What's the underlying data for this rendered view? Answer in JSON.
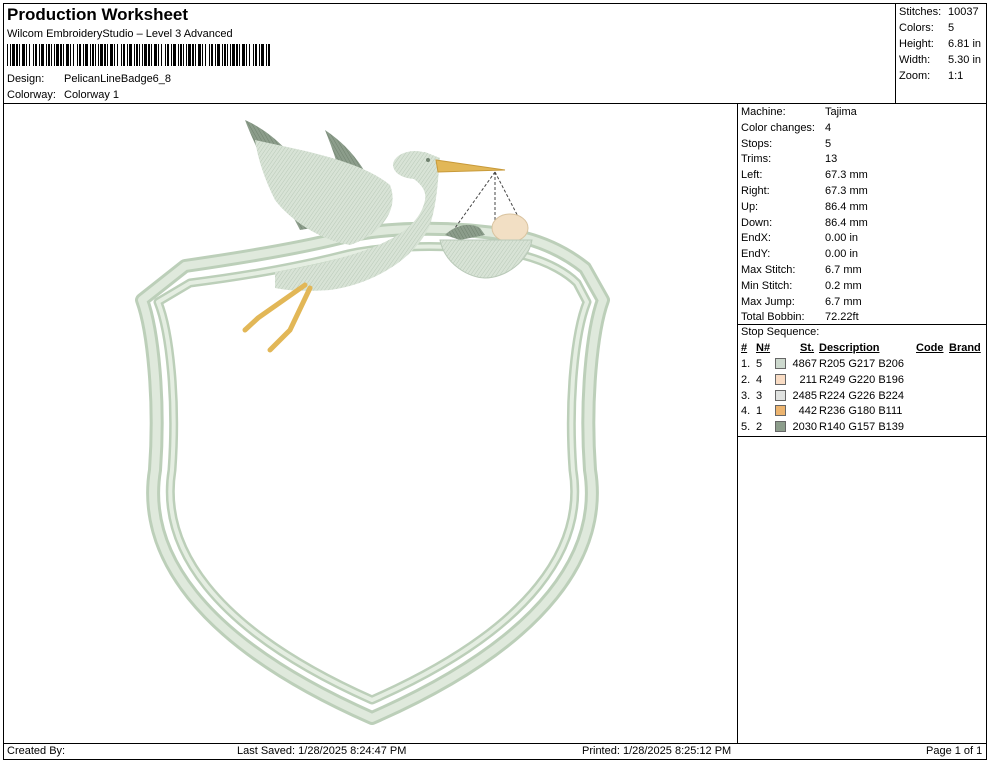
{
  "header": {
    "title": "Production Worksheet",
    "subtitle": "Wilcom EmbroideryStudio – Level 3 Advanced",
    "design_label": "Design:",
    "design_value": "PelicanLineBadge6_8",
    "colorway_label": "Colorway:",
    "colorway_value": "Colorway 1"
  },
  "summary": [
    {
      "label": "Stitches:",
      "value": "10037"
    },
    {
      "label": "Colors:",
      "value": "5"
    },
    {
      "label": "Height:",
      "value": "6.81 in"
    },
    {
      "label": "Width:",
      "value": "5.30 in"
    },
    {
      "label": "Zoom:",
      "value": "1:1"
    }
  ],
  "machine_info": [
    {
      "label": "Machine:",
      "value": "Tajima"
    },
    {
      "label": "Color changes:",
      "value": "4"
    },
    {
      "label": "Stops:",
      "value": "5"
    },
    {
      "label": "Trims:",
      "value": "13"
    },
    {
      "label": "Left:",
      "value": "67.3 mm"
    },
    {
      "label": "Right:",
      "value": "67.3 mm"
    },
    {
      "label": "Up:",
      "value": "86.4 mm"
    },
    {
      "label": "Down:",
      "value": "86.4 mm"
    },
    {
      "label": "EndX:",
      "value": "0.00 in"
    },
    {
      "label": "EndY:",
      "value": "0.00 in"
    },
    {
      "label": "Max Stitch:",
      "value": "6.7 mm"
    },
    {
      "label": "Min Stitch:",
      "value": "0.2 mm"
    },
    {
      "label": "Max Jump:",
      "value": "6.7 mm"
    },
    {
      "label": "Total Bobbin:",
      "value": "72.22ft"
    }
  ],
  "stop_sequence": {
    "title": "Stop Sequence:",
    "columns": [
      "#",
      "N#",
      "St.",
      "Description",
      "Code",
      "Brand"
    ],
    "rows": [
      {
        "idx": "1.",
        "n": "5",
        "st": "4867",
        "desc": "R205 G217 B206",
        "color": "#cdd9ce"
      },
      {
        "idx": "2.",
        "n": "4",
        "st": "211",
        "desc": "R249 G220 B196",
        "color": "#f9dcc4"
      },
      {
        "idx": "3.",
        "n": "3",
        "st": "2485",
        "desc": "R224 G226 B224",
        "color": "#e0e2e0"
      },
      {
        "idx": "4.",
        "n": "1",
        "st": "442",
        "desc": "R236 G180 B111",
        "color": "#ecb46f"
      },
      {
        "idx": "5.",
        "n": "2",
        "st": "2030",
        "desc": "R140 G157 B139",
        "color": "#8c9d8b"
      }
    ]
  },
  "footer": {
    "created_by": "Created By:",
    "last_saved": "Last Saved: 1/28/2025 8:24:47 PM",
    "printed": "Printed: 1/28/2025 8:25:12 PM",
    "page": "Page 1 of 1"
  },
  "colors": {
    "thread_light": "#cdd9ce",
    "thread_peach": "#f9dcc4",
    "thread_grey": "#e0e2e0",
    "thread_gold": "#ecb46f",
    "thread_green": "#8c9d8b"
  }
}
